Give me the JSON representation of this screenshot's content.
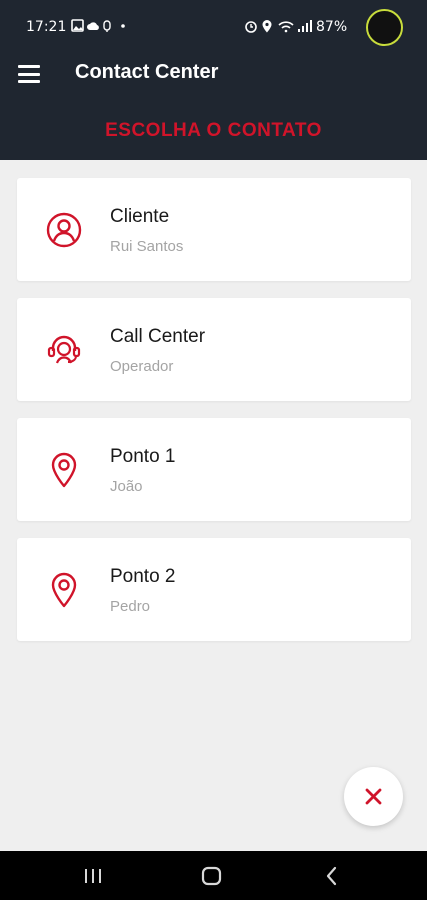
{
  "status_bar": {
    "time": "17:21",
    "left_icons": [
      "image-icon",
      "cloud-icon",
      "fingerprint-icon",
      "dot-icon"
    ],
    "right_icons": [
      "alarm-icon",
      "location-icon",
      "wifi-icon",
      "signal-icon"
    ],
    "battery": "87%"
  },
  "app_bar": {
    "title": "Contact Center",
    "subtitle": "ESCOLHA O CONTATO"
  },
  "contacts": [
    {
      "title": "Cliente",
      "subtitle": "Rui Santos",
      "icon": "user-circle-icon"
    },
    {
      "title": "Call Center",
      "subtitle": "Operador",
      "icon": "headset-icon"
    },
    {
      "title": "Ponto 1",
      "subtitle": "João",
      "icon": "map-pin-icon"
    },
    {
      "title": "Ponto 2",
      "subtitle": "Pedro",
      "icon": "map-pin-icon"
    }
  ],
  "fab": {
    "icon": "close-icon"
  },
  "nav_bar": {
    "buttons": [
      "recents-icon",
      "home-icon",
      "back-icon"
    ]
  },
  "colors": {
    "header_bg": "#1f2630",
    "accent_red": "#d0142a",
    "page_bg": "#efefef",
    "card_bg": "#ffffff",
    "subtitle_gray": "#a4a4a4"
  }
}
